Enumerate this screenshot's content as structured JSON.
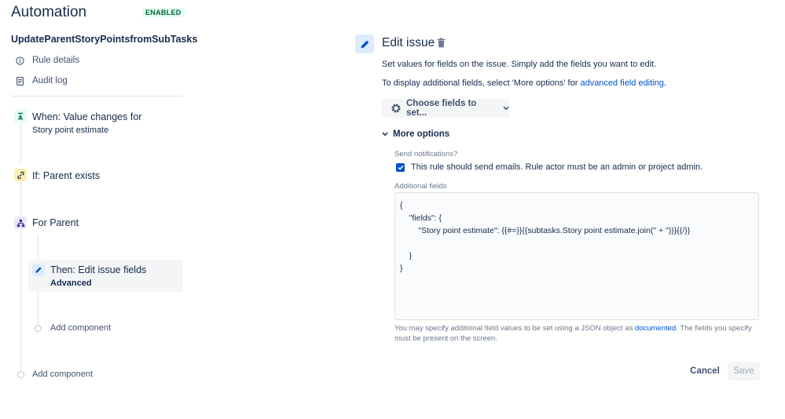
{
  "header": {
    "title": "Automation",
    "status_badge": "ENABLED"
  },
  "rule": {
    "name": "UpdateParentStoryPointsfromSubTasks"
  },
  "nav": [
    {
      "label": "Rule details",
      "icon": "info-circle-icon"
    },
    {
      "label": "Audit log",
      "icon": "document-icon"
    }
  ],
  "components": {
    "trigger": {
      "title": "When: Value changes for",
      "subtitle": "Story point estimate",
      "icon": "trigger-icon"
    },
    "condition": {
      "title": "If: Parent exists",
      "icon": "link-icon"
    },
    "branch": {
      "title": "For Parent",
      "icon": "hierarchy-icon"
    },
    "action": {
      "title": "Then: Edit issue fields",
      "subtitle": "Advanced",
      "icon": "pencil-icon"
    },
    "add_inner": "Add component",
    "add_outer": "Add component"
  },
  "editor": {
    "title": "Edit issue",
    "desc1": "Set values for fields on the issue. Simply add the fields you want to edit.",
    "desc2_prefix": "To display additional fields, select 'More options' for ",
    "desc2_link": "advanced field editing",
    "desc2_suffix": ".",
    "choose_fields_label": "Choose fields to set...",
    "more_options_label": "More options",
    "send_notifications_label": "Send notifications?",
    "send_emails_checked": true,
    "send_emails_text": "This rule should send emails. Rule actor must be an admin or project admin.",
    "additional_fields_label": "Additional fields",
    "code_lines": [
      "{",
      "    \"fields\": {",
      "        \"Story point estimate\": {{#=}}{{subtasks.Story point estimate.join(\" + \")}}{{/}}",
      "",
      "    }",
      "}"
    ],
    "help_prefix": "You may specify additional field values to be set using a JSON object as ",
    "help_link": "documented",
    "help_suffix": ". The fields you specify must be present on the screen.",
    "cancel_label": "Cancel",
    "save_label": "Save"
  },
  "colors": {
    "accent": "#0052cc",
    "enabled_badge_bg": "#e3fcef",
    "enabled_badge_text": "#006644",
    "selected_bg": "#f4f5f7"
  }
}
